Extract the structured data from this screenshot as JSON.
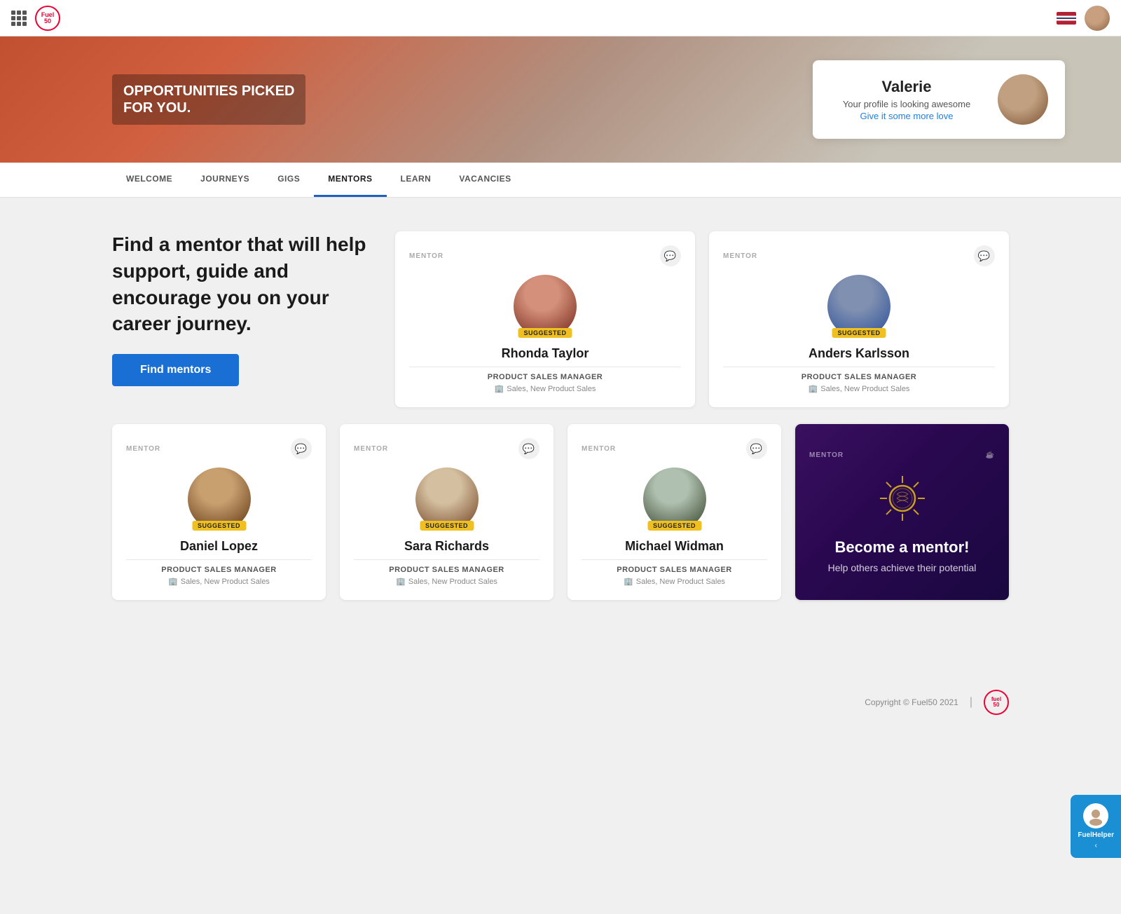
{
  "header": {
    "logo_text": "Fuel\n50",
    "footer_logo_text": "fuel\n50"
  },
  "hero": {
    "title_line1": "OPPORTUNITIES PICKED",
    "title_line2": "FOR YOU.",
    "profile_name": "Valerie",
    "profile_sub": "Your profile is looking awesome",
    "profile_link": "Give it some more love"
  },
  "nav": {
    "items": [
      {
        "label": "WELCOME",
        "active": false
      },
      {
        "label": "JOURNEYS",
        "active": false
      },
      {
        "label": "GIGS",
        "active": false
      },
      {
        "label": "MENTORS",
        "active": true
      },
      {
        "label": "LEARN",
        "active": false
      },
      {
        "label": "VACANCIES",
        "active": false
      }
    ]
  },
  "main": {
    "headline": "Find a mentor that will help support, guide and encourage you on your career journey.",
    "find_btn": "Find mentors",
    "mentor_label": "MENTOR",
    "suggested_badge": "SUGGESTED",
    "mentors": [
      {
        "name": "Rhonda Taylor",
        "role": "PRODUCT SALES MANAGER",
        "tags": "Sales, New Product Sales",
        "avatar_class": "avatar-rhonda"
      },
      {
        "name": "Anders Karlsson",
        "role": "PRODUCT SALES MANAGER",
        "tags": "Sales, New Product Sales",
        "avatar_class": "avatar-anders"
      },
      {
        "name": "Daniel Lopez",
        "role": "PRODUCT SALES MANAGER",
        "tags": "Sales, New Product Sales",
        "avatar_class": "avatar-daniel"
      },
      {
        "name": "Sara Richards",
        "role": "PRODUCT SALES MANAGER",
        "tags": "Sales, New Product Sales",
        "avatar_class": "avatar-sara"
      },
      {
        "name": "Michael Widman",
        "role": "PRODUCT SALES MANAGER",
        "tags": "Sales, New Product Sales",
        "avatar_class": "avatar-michael"
      }
    ],
    "become_title": "Become a mentor!",
    "become_sub": "Help others achieve their potential"
  },
  "footer": {
    "copyright": "Copyright © Fuel50 2021",
    "divider": "|",
    "logo_text": "fuel\n50"
  },
  "fuel_helper": {
    "label": "FuelHelper",
    "arrow": "‹"
  }
}
